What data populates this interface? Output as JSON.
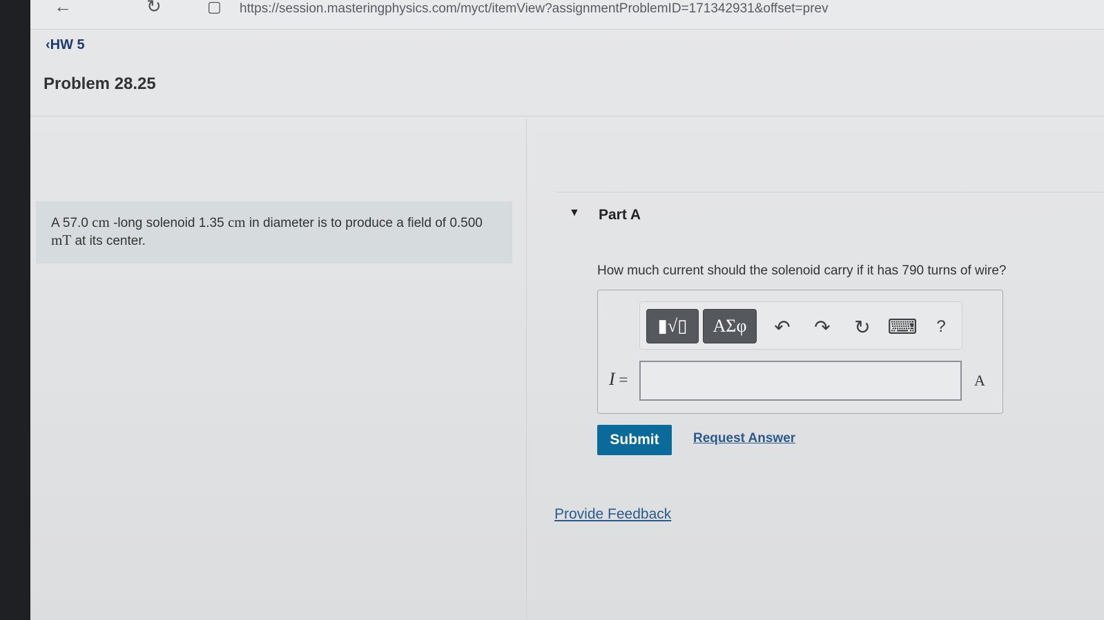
{
  "browser": {
    "url": "https://session.masteringphysics.com/myct/itemView?assignmentProblemID=171342931&offset=prev"
  },
  "nav": {
    "back_label": "HW 5",
    "back_chevron": "‹"
  },
  "problem": {
    "title": "Problem 28.25",
    "statement": {
      "t1": "A 57.0 ",
      "u1": "cm",
      "t2": " -long solenoid 1.35 ",
      "u2": "cm",
      "t3": " in diameter is to produce a field of 0.500 ",
      "u3": "mT",
      "t4": " at its center."
    }
  },
  "part": {
    "title": "Part A",
    "question": "How much current should the solenoid carry if it has 790 turns of wire?",
    "variable": "I",
    "equals": "=",
    "answer_value": "",
    "unit": "A"
  },
  "toolbar": {
    "templates_label": "▮√▯",
    "symbols_label": "ΑΣφ",
    "undo_glyph": "↶",
    "redo_glyph": "↷",
    "reset_glyph": "↻",
    "keyboard_glyph": "⌨",
    "help_glyph": "?"
  },
  "actions": {
    "submit": "Submit",
    "request_answer": "Request Answer",
    "feedback": "Provide Feedback"
  },
  "icons": {
    "back_arrow": "←",
    "reload": "↻",
    "tab_square": "▢",
    "part_caret": "▼"
  },
  "colors": {
    "submit_bg": "#0a6b9a",
    "link": "#2a5a8a"
  }
}
